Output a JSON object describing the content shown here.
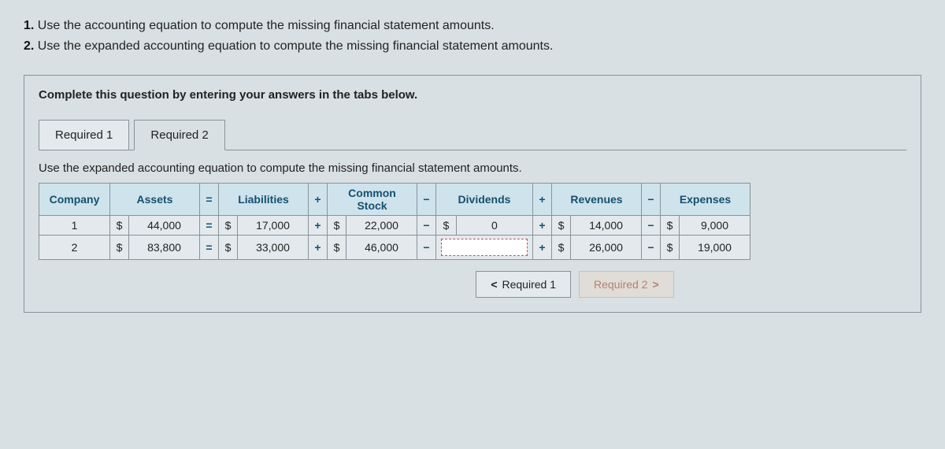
{
  "instructions": {
    "line1_num": "1.",
    "line1_text": " Use the accounting equation to compute the missing financial statement amounts.",
    "line2_num": "2.",
    "line2_text": " Use the expanded accounting equation to compute the missing financial statement amounts."
  },
  "complete_text": "Complete this question by entering your answers in the tabs below.",
  "tabs": {
    "req1": "Required 1",
    "req2": "Required 2"
  },
  "tab_desc": "Use the expanded accounting equation to compute the missing financial statement amounts.",
  "table": {
    "headers": {
      "company": "Company",
      "assets": "Assets",
      "eq": "=",
      "liabilities": "Liabilities",
      "plus": "+",
      "common_stock": "Common Stock",
      "minus": "−",
      "dividends": "Dividends",
      "revenues": "Revenues",
      "expenses": "Expenses"
    },
    "rows": [
      {
        "company": "1",
        "assets": "44,000",
        "liabilities": "17,000",
        "common_stock": "22,000",
        "dividends": "0",
        "revenues": "14,000",
        "expenses": "9,000"
      },
      {
        "company": "2",
        "assets": "83,800",
        "liabilities": "33,000",
        "common_stock": "46,000",
        "dividends": "",
        "revenues": "26,000",
        "expenses": "19,000"
      }
    ],
    "dollar": "$",
    "op_eq": "=",
    "op_plus": "+",
    "op_minus": "−"
  },
  "nav": {
    "prev": "Required 1",
    "next": "Required 2",
    "chev_left": "<",
    "chev_right": ">"
  }
}
